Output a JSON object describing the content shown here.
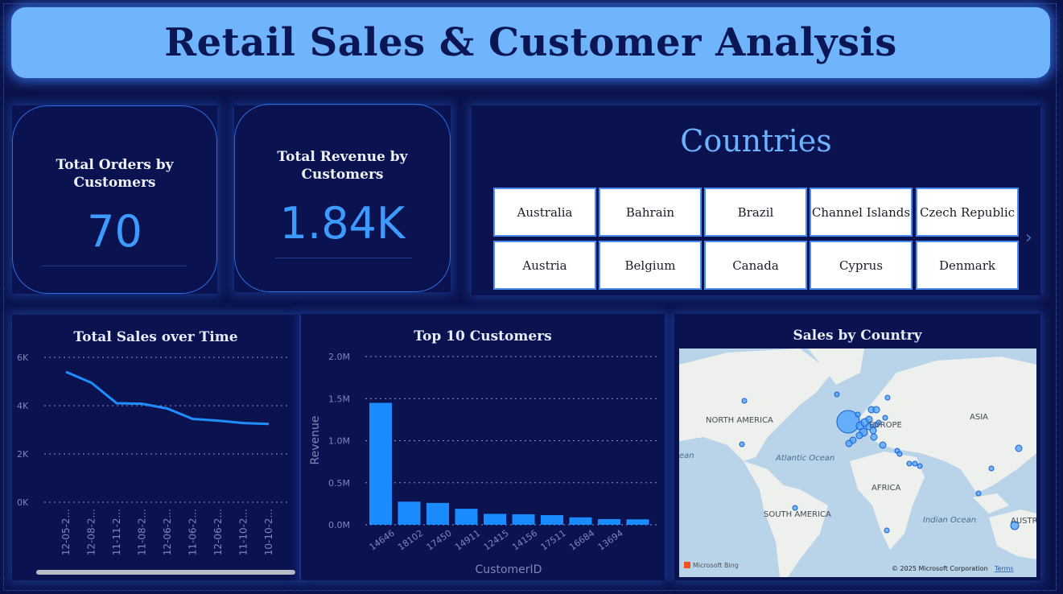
{
  "header": {
    "title": "Retail Sales & Customer Analysis"
  },
  "kpis": [
    {
      "label": "Total Orders by Customers",
      "value": "70"
    },
    {
      "label": "Total Revenue by Customers",
      "value": "1.84K"
    }
  ],
  "countries": {
    "title": "Countries",
    "items": [
      "Australia",
      "Bahrain",
      "Brazil",
      "Channel Islands",
      "Czech Republic",
      "Austria",
      "Belgium",
      "Canada",
      "Cyprus",
      "Denmark"
    ]
  },
  "map": {
    "title": "Sales by Country",
    "labels": [
      "NORTH AMERICA",
      "ASIA",
      "EUROPE",
      "Atlantic Ocean",
      "AFRICA",
      "SOUTH AMERICA",
      "Indian Ocean",
      "AUSTRAL",
      "ean"
    ],
    "attribution": "© 2025 Microsoft Corporation",
    "terms": "Terms",
    "provider": "Microsoft Bing"
  },
  "chart_data": [
    {
      "type": "line",
      "title": "Total Sales over Time",
      "x": [
        "12-05-2...",
        "12-08-2...",
        "11-11-2...",
        "11-08-2...",
        "12-06-2...",
        "11-06-2...",
        "12-06-2...",
        "11-10-2...",
        "10-10-2..."
      ],
      "series": [
        {
          "values": [
            5400,
            4950,
            4100,
            4080,
            3880,
            3450,
            3380,
            3280,
            3240
          ]
        }
      ],
      "yticks": [
        "6K",
        "4K",
        "2K",
        "0K"
      ],
      "ylim": [
        0,
        6000
      ],
      "grid": true,
      "colors": {
        "line": "#1f8fff"
      }
    },
    {
      "type": "bar",
      "title": "Top 10 Customers",
      "xlabel": "CustomerID",
      "ylabel": "Revenue",
      "categories": [
        "14646",
        "18102",
        "17450",
        "14911",
        "12415",
        "14156",
        "17511",
        "16684",
        "13694"
      ],
      "values": [
        1450000,
        275000,
        260000,
        190000,
        130000,
        125000,
        115000,
        88000,
        68000,
        65000
      ],
      "bar_labels_hidden_indices": [],
      "yticks": [
        "2.0M",
        "1.5M",
        "1.0M",
        "0.5M",
        "0.0M"
      ],
      "ylim": [
        0,
        2000000
      ],
      "grid": true,
      "colors": {
        "bar": "#1a8cff"
      }
    }
  ]
}
